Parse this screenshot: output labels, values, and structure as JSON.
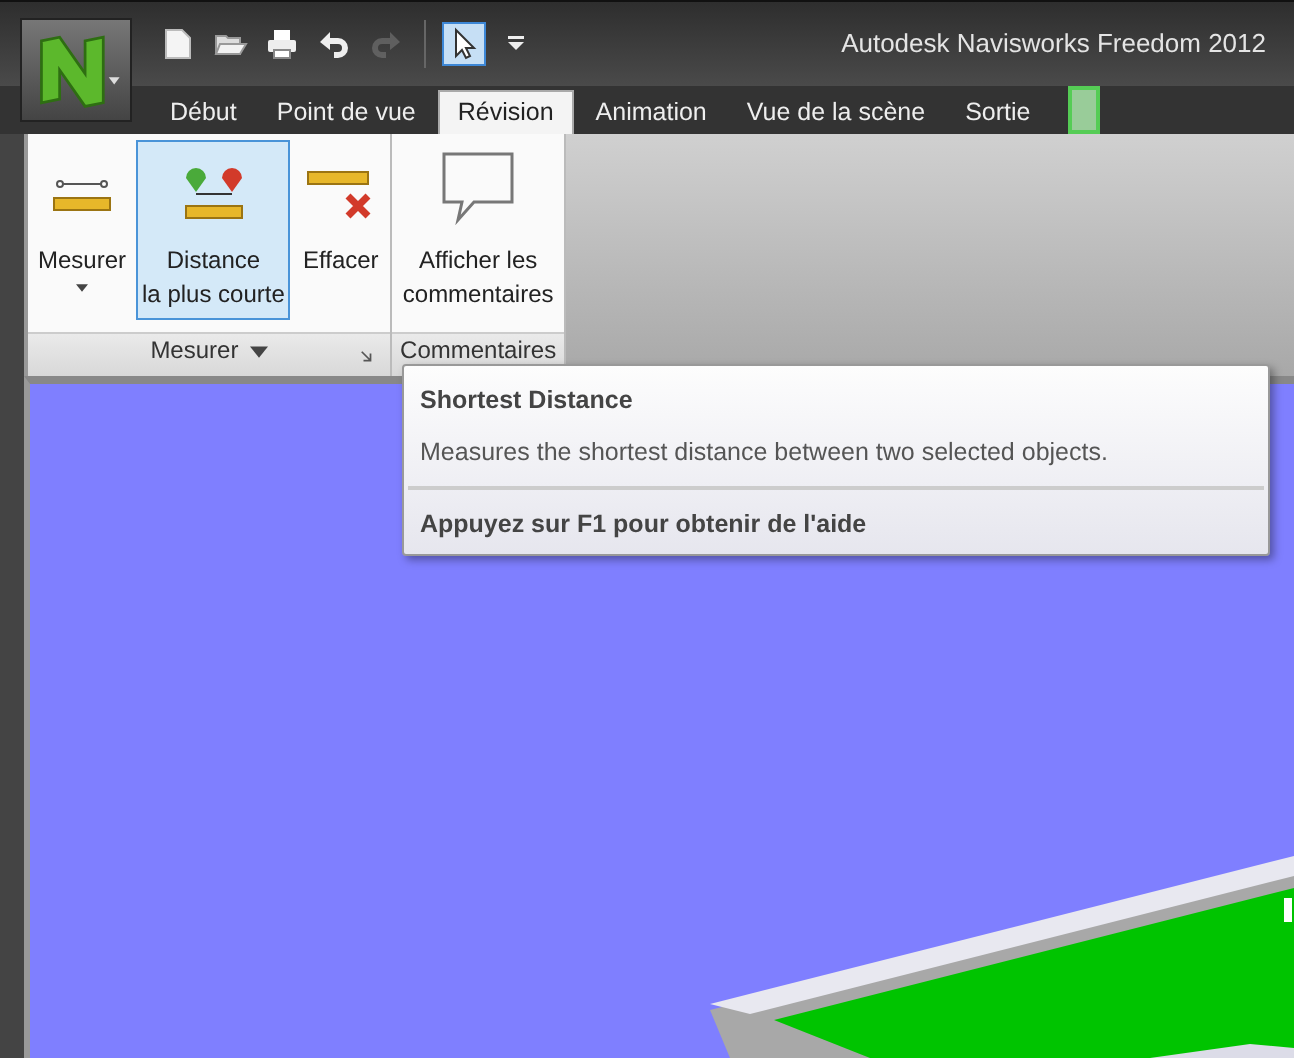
{
  "window": {
    "title": "Autodesk Navisworks Freedom 2012"
  },
  "quick_access": [
    {
      "kind": "new",
      "disabled": false,
      "selected": false
    },
    {
      "kind": "open",
      "disabled": false,
      "selected": false
    },
    {
      "kind": "print",
      "disabled": false,
      "selected": false
    },
    {
      "kind": "undo",
      "disabled": false,
      "selected": false
    },
    {
      "kind": "redo",
      "disabled": true,
      "selected": false
    },
    {
      "kind": "select",
      "disabled": false,
      "selected": true
    },
    {
      "kind": "more",
      "disabled": false,
      "selected": false
    }
  ],
  "tabs": [
    {
      "label": "Début",
      "selected": false
    },
    {
      "label": "Point de vue",
      "selected": false
    },
    {
      "label": "Révision",
      "selected": true
    },
    {
      "label": "Animation",
      "selected": false
    },
    {
      "label": "Vue de la scène",
      "selected": false
    },
    {
      "label": "Sortie",
      "selected": false
    }
  ],
  "ribbon_panels": [
    {
      "label": "Mesurer",
      "dropdown": true,
      "launcher": true,
      "buttons": [
        {
          "kind": "measure",
          "label": "Mesurer",
          "dropdown": true,
          "selected": false
        },
        {
          "kind": "shortest",
          "label": "Distance\nla plus courte",
          "dropdown": false,
          "selected": true
        },
        {
          "kind": "clear",
          "label": "Effacer",
          "dropdown": false,
          "selected": false
        }
      ]
    },
    {
      "label": "Commentaires",
      "dropdown": false,
      "launcher": false,
      "buttons": [
        {
          "kind": "comments",
          "label": "Afficher les\ncommentaires",
          "dropdown": false,
          "selected": false
        }
      ]
    }
  ],
  "tooltip": {
    "title": "Shortest Distance",
    "description": "Measures the shortest distance between two selected objects.",
    "help": "Appuyez sur F1 pour obtenir de l'aide"
  }
}
